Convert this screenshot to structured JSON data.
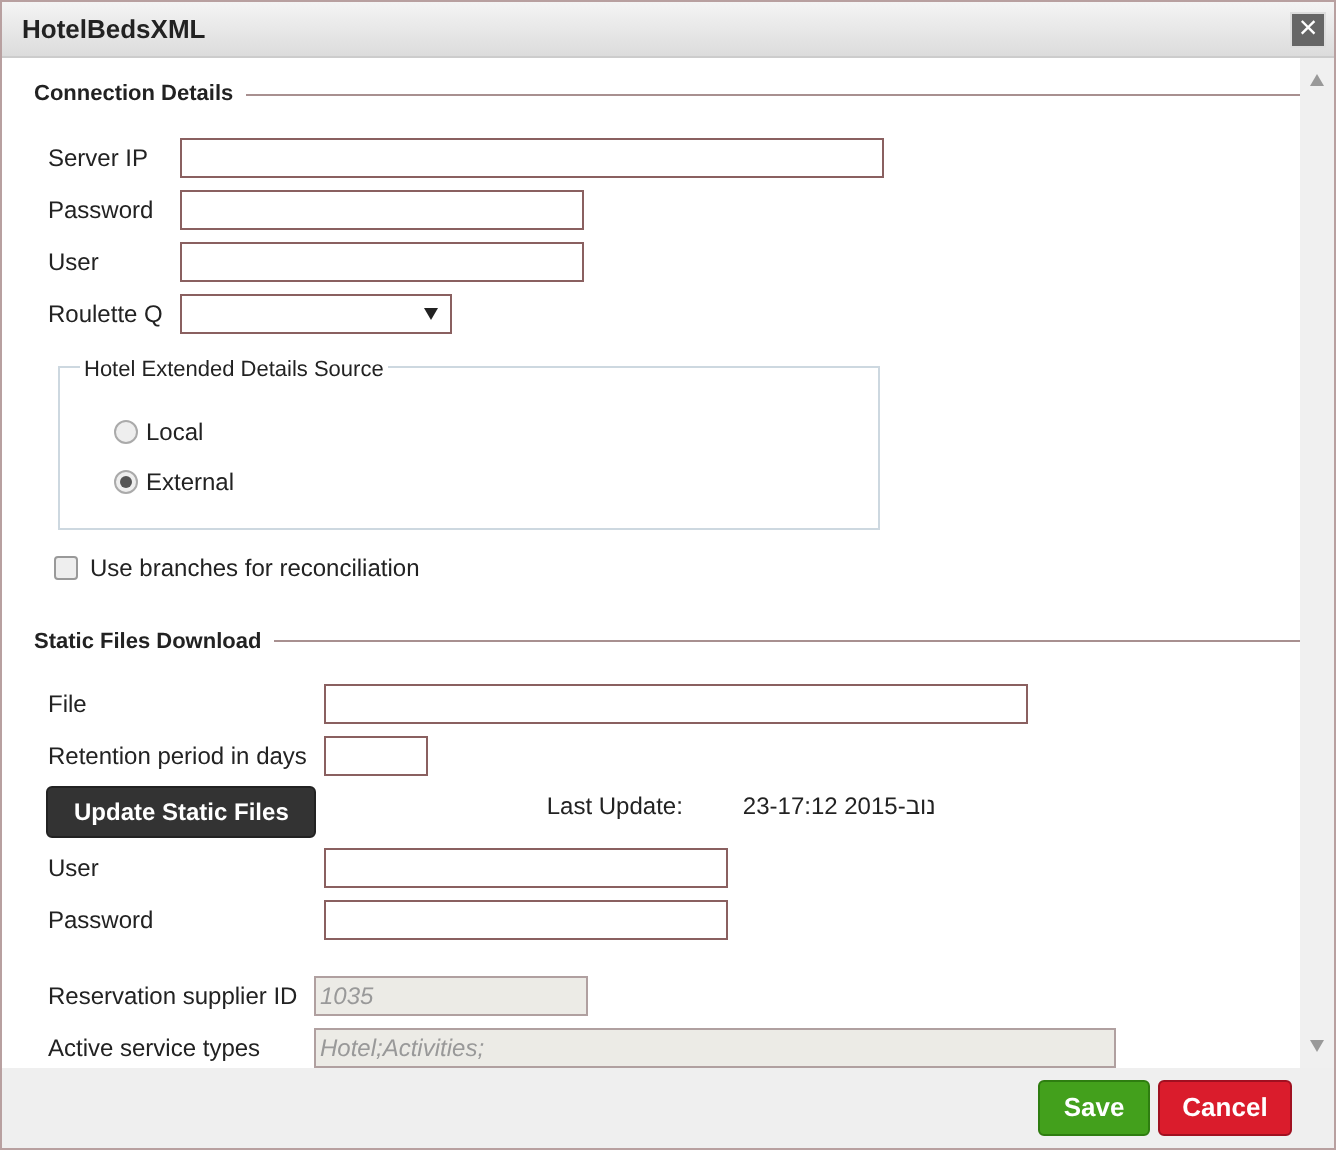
{
  "window": {
    "title": "HotelBedsXML",
    "close": "×"
  },
  "sections": [
    {
      "title": "Connection Details",
      "rows": [
        {
          "kind": "field",
          "label": "Server IP"
        },
        {
          "kind": "field",
          "label": "Password"
        },
        {
          "kind": "field",
          "label": "User"
        },
        {
          "kind": "select",
          "label": "Roulette Q"
        },
        {
          "kind": "radio-group",
          "legend": "Hotel Extended Details Source",
          "options": [
            {
              "label": "Local",
              "selected": false
            },
            {
              "label": "External",
              "selected": true
            }
          ]
        },
        {
          "kind": "checkbox",
          "label": "Use branches for reconciliation",
          "checked": false
        }
      ]
    },
    {
      "title": "Static Files Download",
      "rows": [
        {
          "kind": "field",
          "label": "File"
        },
        {
          "kind": "field",
          "label": "Retention period in days"
        },
        {
          "kind": "action",
          "button": "Update Static Files",
          "info_label": "Last Update:",
          "info_value": "23-17:12 2015-נוב"
        },
        {
          "kind": "field",
          "label": "User"
        },
        {
          "kind": "field",
          "label": "Password"
        },
        {
          "kind": "field",
          "label": "Reservation supplier ID",
          "value": "1035",
          "disabled": true
        },
        {
          "kind": "field",
          "label": "Active service types",
          "value": "Hotel;Activities;",
          "disabled": true
        }
      ]
    }
  ],
  "buttons": [
    {
      "label": "Save"
    },
    {
      "label": "Cancel"
    }
  ]
}
